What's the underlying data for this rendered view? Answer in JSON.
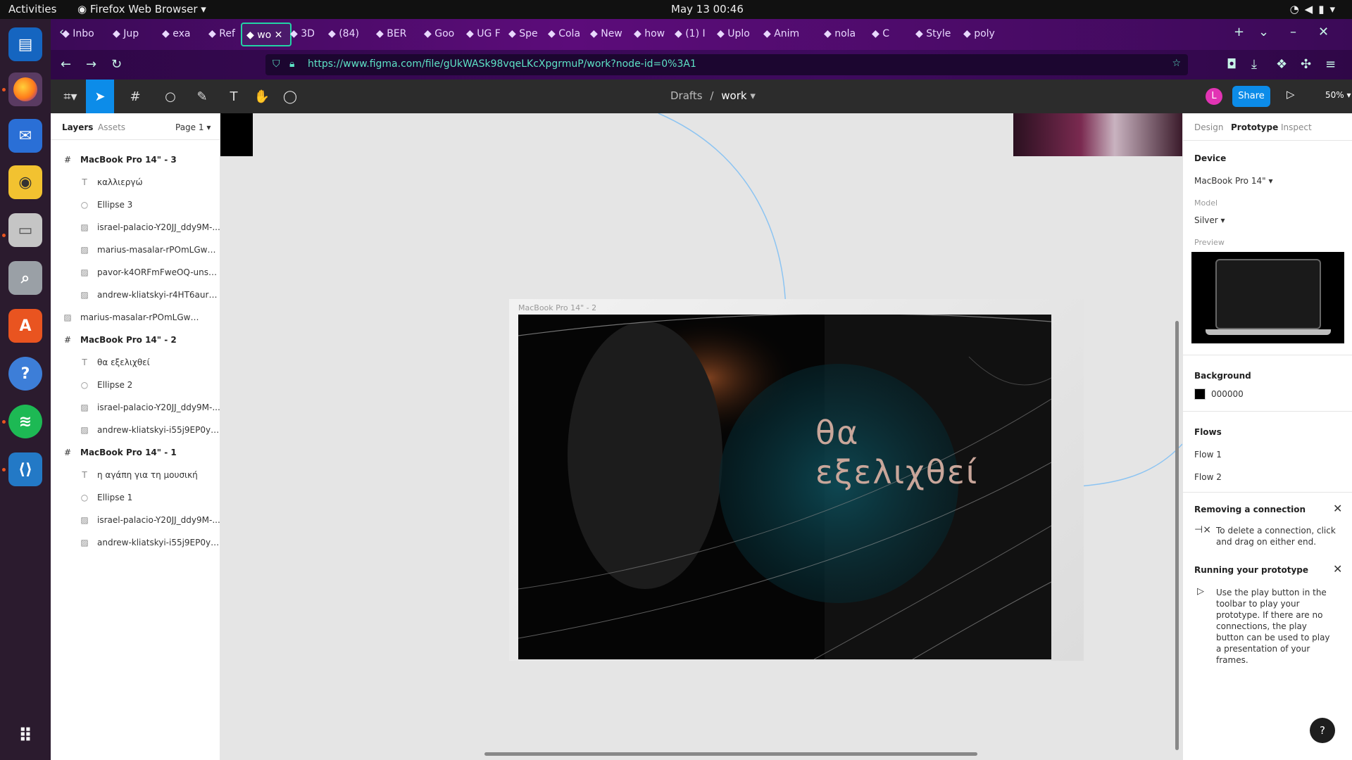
{
  "system_bar": {
    "activities": "Activities",
    "app_name": "Firefox Web Browser",
    "clock": "May 13  00:46"
  },
  "browser": {
    "tabs": [
      "Inbo",
      "Jup",
      "exa",
      "Ref",
      "wo",
      "3D",
      "(84)",
      "BER",
      "Goo",
      "UG F",
      "Spe",
      "Cola",
      "New",
      "how",
      "(1) I",
      "Uplo",
      "Anim",
      "nola",
      "C",
      "Style",
      "poly"
    ],
    "url": "https://www.figma.com/file/gUkWASk98vqeLKcXpgrmuP/work?node-id=0%3A1"
  },
  "figma": {
    "breadcrumb_parent": "Drafts",
    "breadcrumb_sep": "/",
    "file_name": "work",
    "avatar_initial": "L",
    "share_label": "Share",
    "zoom": "50%"
  },
  "layers_panel": {
    "tab_layers": "Layers",
    "tab_assets": "Assets",
    "page": "Page 1",
    "items": [
      {
        "type": "frame",
        "name": "MacBook Pro 14\" - 3"
      },
      {
        "type": "text",
        "name": "καλλιεργώ"
      },
      {
        "type": "ellipse",
        "name": "Ellipse 3"
      },
      {
        "type": "image",
        "name": "israel-palacio-Y20JJ_ddy9M-..."
      },
      {
        "type": "image",
        "name": "marius-masalar-rPOmLGwai2..."
      },
      {
        "type": "image",
        "name": "pavor-k4ORFmFweOQ-unspla..."
      },
      {
        "type": "image",
        "name": "andrew-kliatskyi-r4HT6aurLQ..."
      },
      {
        "type": "image-top",
        "name": "marius-masalar-rPOmLGwai2w-un..."
      },
      {
        "type": "frame",
        "name": "MacBook Pro 14\" - 2"
      },
      {
        "type": "text",
        "name": "θα εξελιχθεί"
      },
      {
        "type": "ellipse",
        "name": "Ellipse 2"
      },
      {
        "type": "image",
        "name": "israel-palacio-Y20JJ_ddy9M-..."
      },
      {
        "type": "image",
        "name": "andrew-kliatskyi-i55j9EP0ynA..."
      },
      {
        "type": "frame",
        "name": "MacBook Pro 14\" - 1"
      },
      {
        "type": "text",
        "name": "η αγάπη για τη μουσική"
      },
      {
        "type": "ellipse",
        "name": "Ellipse 1"
      },
      {
        "type": "image",
        "name": "israel-palacio-Y20JJ_ddy9M-..."
      },
      {
        "type": "image",
        "name": "andrew-kliatskyi-i55j9EP0ynA..."
      }
    ]
  },
  "canvas": {
    "frame_label": "MacBook Pro 14\" - 2",
    "frame_text_line1": "θα",
    "frame_text_line2": "εξελιχθεί"
  },
  "right_panel": {
    "tab_design": "Design",
    "tab_prototype": "Prototype",
    "tab_inspect": "Inspect",
    "device_title": "Device",
    "device_value": "MacBook Pro 14\"",
    "model_label": "Model",
    "model_value": "Silver",
    "preview_label": "Preview",
    "background_title": "Background",
    "background_value": "000000",
    "flows_title": "Flows",
    "flow1": "Flow 1",
    "flow2": "Flow 2",
    "removing_title": "Removing a connection",
    "removing_text": "To delete a connection, click and drag on either end.",
    "running_title": "Running your prototype",
    "running_text": "Use the play button in the toolbar to play your prototype. If there are no connections, the play button can be used to play a presentation of your frames.",
    "help": "?"
  },
  "colors": {
    "figma_blue": "#0c8ce9",
    "frame_bg": "#000000",
    "connector": "#8cc4f2"
  }
}
